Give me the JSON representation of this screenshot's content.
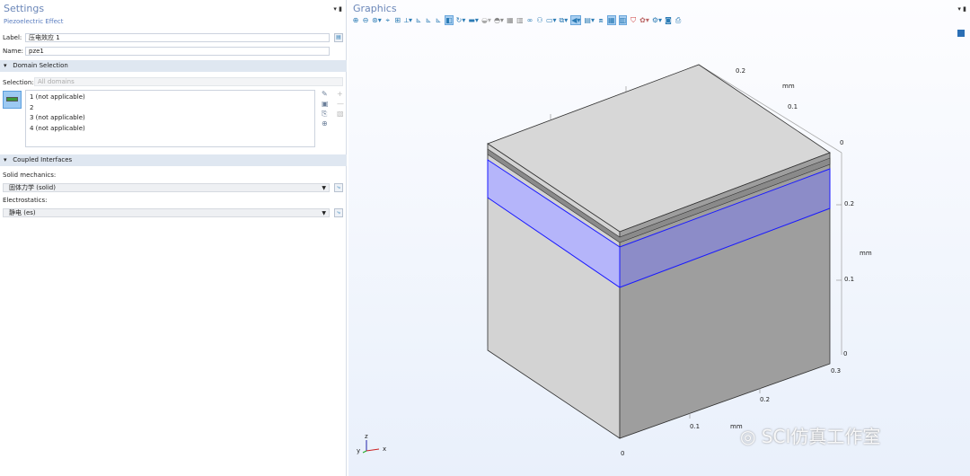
{
  "settings": {
    "title": "Settings",
    "subtitle": "Piezoelectric Effect",
    "label_label": "Label:",
    "label_value": "压电效应 1",
    "name_label": "Name:",
    "name_value": "pze1",
    "domain_section": "Domain Selection",
    "selection_label": "Selection:",
    "selection_value": "All domains",
    "domains": [
      "1 (not applicable)",
      "2",
      "3 (not applicable)",
      "4 (not applicable)"
    ],
    "coupled_section": "Coupled Interfaces",
    "solid_label": "Solid mechanics:",
    "solid_value": "固体力学 (solid)",
    "electro_label": "Electrostatics:",
    "electro_value": "静电 (es)"
  },
  "graphics": {
    "title": "Graphics",
    "axis_labels": {
      "top_02": "0.2",
      "top_mm": "mm",
      "top_01": "0.1",
      "r_0a": "0",
      "r_02": "0.2",
      "r_mm": "mm",
      "r_01": "0.1",
      "r_0b": "0",
      "b_03": "0.3",
      "b_02": "0.2",
      "b_mm": "mm",
      "b_01": "0.1",
      "b_0": "0"
    },
    "triad": {
      "z": "z",
      "y": "y",
      "x": "x"
    },
    "watermark": "SCI仿真工作室",
    "colors": {
      "selected_domain": "#b3b3f5",
      "edge_selected": "#1a1aff"
    }
  }
}
